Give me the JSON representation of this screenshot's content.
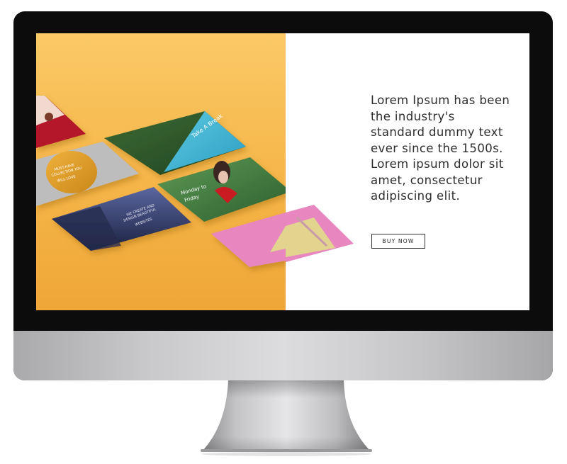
{
  "hero": {
    "text": "Lorem Ipsum has been the industry's standard dummy text ever since the 1500s. Lorem ipsum dolor sit amet, consectetur adipiscing elit.",
    "button_label": "BUY NOW"
  },
  "cards": {
    "travel_title": "Take A Break",
    "badge_line1": "MUST-HAVE",
    "badge_line2": "COLLECTION YOU",
    "badge_line3": "WILL LOVE",
    "night_line1": "WE CREATE AND",
    "night_line2": "DESIGN BEAUTIFUL",
    "night_line3": "WEBSITES",
    "monday_line1": "Monday to",
    "monday_line2": "Friday"
  },
  "colors": {
    "yellow_top": "#fbc966",
    "yellow_bottom": "#efa637",
    "bezel": "#0c0c0c",
    "pink": "#e887bf",
    "forest": "#2f5a2f",
    "lake": "#45b7d6"
  }
}
